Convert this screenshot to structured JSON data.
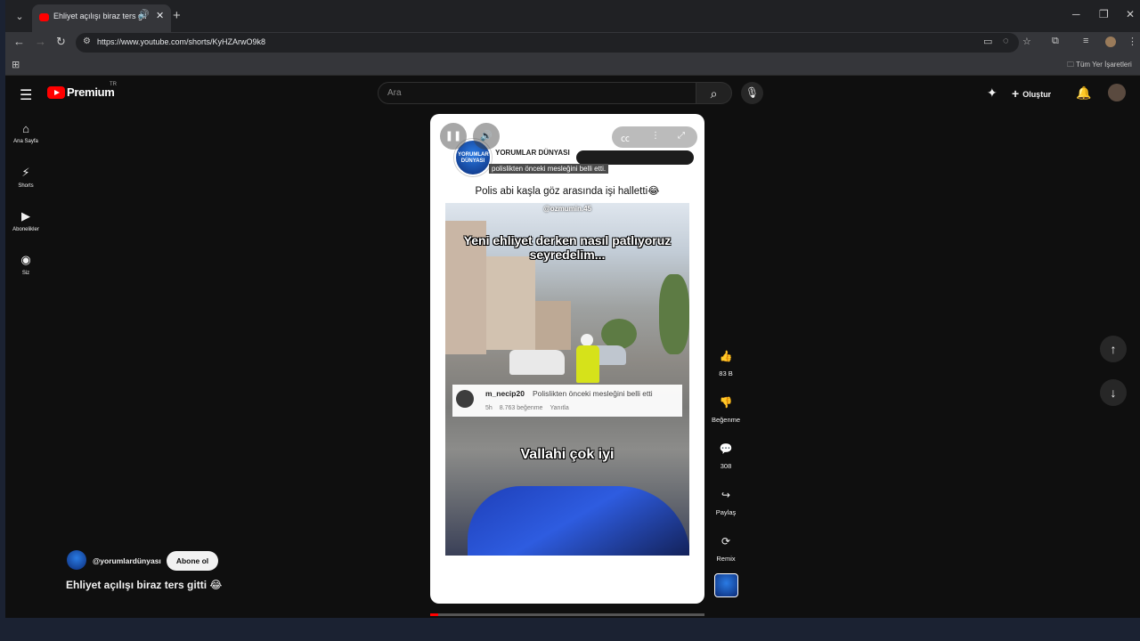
{
  "browser": {
    "tab": {
      "title": "Ehliyet açılışı biraz ters gitti 😂",
      "audio_icon": "🔊",
      "close": "✕"
    },
    "new_tab": "+",
    "window": {
      "minimize": "─",
      "maximize": "❐",
      "close": "✕"
    },
    "url": "https://www.youtube.com/shorts/KyHZArwO9k8",
    "bookmarks_all": "Tüm Yer İşaretleri"
  },
  "youtube": {
    "logo_text": "Premium",
    "country": "TR",
    "search_placeholder": "Ara",
    "create_label": "Oluştur",
    "sidebar": [
      {
        "icon": "home-icon",
        "glyph": "⌂",
        "label": "Ana Sayfa"
      },
      {
        "icon": "shorts-icon",
        "glyph": "⚡",
        "label": "Shorts"
      },
      {
        "icon": "subscriptions-icon",
        "glyph": "▶",
        "label": "Abonelikler"
      },
      {
        "icon": "you-icon",
        "glyph": "◉",
        "label": "Siz"
      }
    ]
  },
  "short": {
    "channel_title": "YORUMLAR DÜNYASI",
    "caption": "polislikten önceki mesleğini belli etti.",
    "headline": "Polis abi kaşla göz arasında işi halletti😂",
    "watermark": "@ozmumin.45",
    "overlay_top": "Yeni ehliyet derken nasıl patlıyoruz seyredelim...",
    "overlay_bottom": "Vallahi çok iyi",
    "comment": {
      "user": "m_necip20",
      "text": "Polislikten önceki mesleğini belli etti",
      "time": "5h",
      "likes": "8.763 beğenme",
      "reply": "Yanıtla"
    },
    "progress_fraction": 0.03
  },
  "actions": {
    "like_count": "83 B",
    "dislike_label": "Beğenme",
    "comment_count": "308",
    "share_label": "Paylaş",
    "remix_label": "Remix"
  },
  "channel": {
    "handle": "@yorumlardünyası",
    "subscribe_label": "Abone ol",
    "video_title": "Ehliyet açılışı biraz ters gitti 😂"
  }
}
